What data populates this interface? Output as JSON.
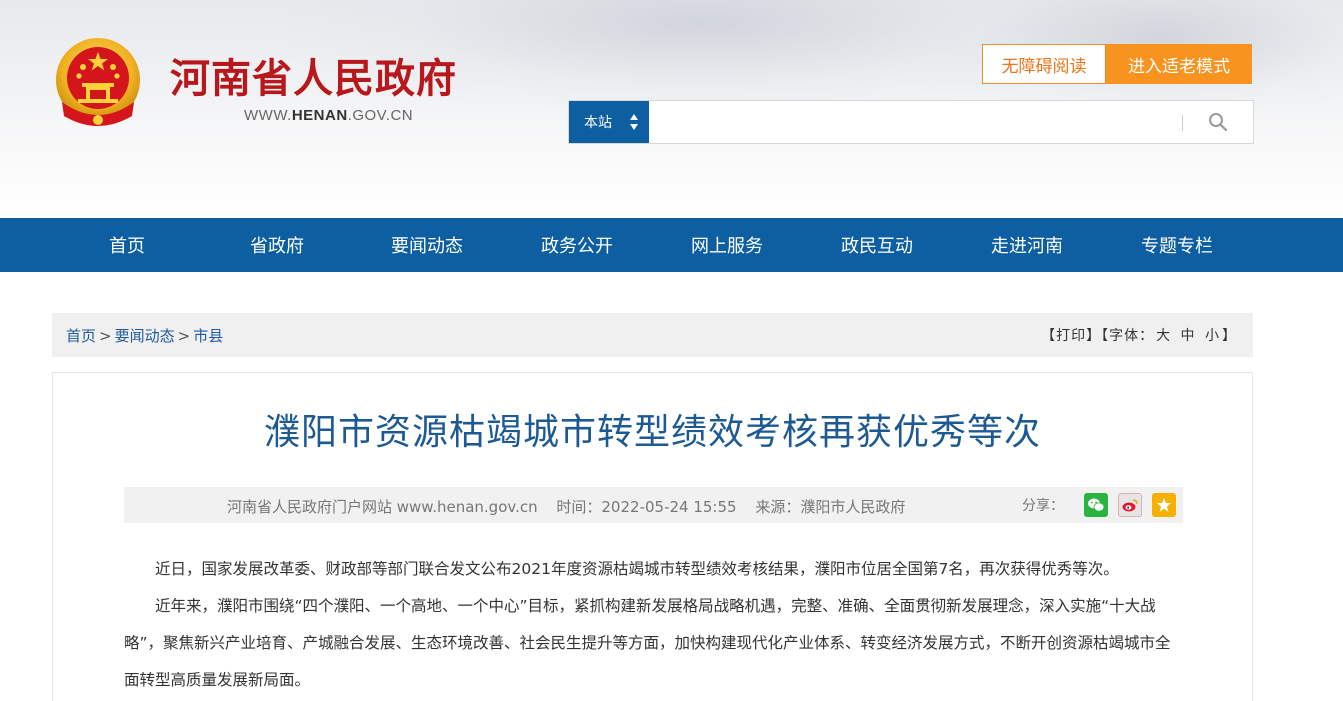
{
  "header": {
    "site_title": "河南省人民政府",
    "site_url_prefix": "WWW.",
    "site_url_domain": "HENAN",
    "site_url_suffix": ".GOV.CN",
    "accessible_reading_label": "无障碍阅读",
    "elder_mode_label": "进入适老模式",
    "emblem_icon": "national-emblem-icon"
  },
  "search": {
    "scope_label": "本站",
    "query": "",
    "button_icon": "search-icon"
  },
  "nav": {
    "items": [
      {
        "label": "首页"
      },
      {
        "label": "省政府"
      },
      {
        "label": "要闻动态"
      },
      {
        "label": "政务公开"
      },
      {
        "label": "网上服务"
      },
      {
        "label": "政民互动"
      },
      {
        "label": "走进河南"
      },
      {
        "label": "专题专栏"
      }
    ]
  },
  "breadcrumb": {
    "items": [
      "首页",
      "要闻动态",
      "市县"
    ],
    "separator": ">"
  },
  "tools": {
    "print_label": "【打印】",
    "font_label_prefix": "【字体：",
    "font_large": "大",
    "font_medium": "中",
    "font_small": "小",
    "font_label_suffix": "】"
  },
  "article": {
    "title": "濮阳市资源枯竭城市转型绩效考核再获优秀等次",
    "meta": {
      "source_site": "河南省人民政府门户网站 www.henan.gov.cn",
      "time": "时间：2022-05-24 15:55",
      "origin": "来源：濮阳市人民政府"
    },
    "share_label": "分享：",
    "share_icons": [
      "wechat-icon",
      "weibo-icon",
      "favorite-icon"
    ],
    "paragraphs": [
      "近日，国家发展改革委、财政部等部门联合发文公布2021年度资源枯竭城市转型绩效考核结果，濮阳市位居全国第7名，再次获得优秀等次。",
      "近年来，濮阳市围绕“四个濮阳、一个高地、一个中心”目标，紧抓构建新发展格局战略机遇，完整、准确、全面贯彻新发展理念，深入实施“十大战略”，聚焦新兴产业培育、产城融合发展、生态环境改善、社会民生提升等方面，加快构建现代化产业体系、转变经济发展方式，不断开创资源枯竭城市全面转型高质量发展新局面。"
    ]
  },
  "colors": {
    "brand_blue": "#0d5fa1",
    "title_red": "#b8181b",
    "accent_orange": "#f7931e",
    "article_title_blue": "#1d5a94"
  }
}
